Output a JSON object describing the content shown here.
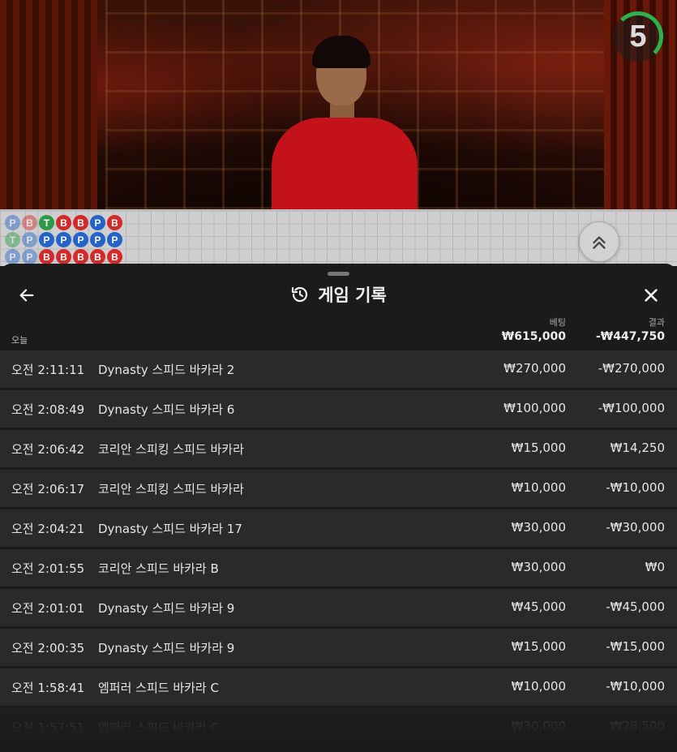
{
  "timer": {
    "value": "5"
  },
  "roadmap": {
    "beads": [
      [
        {
          "l": "P",
          "dim": true
        },
        {
          "l": "T",
          "dim": true
        },
        {
          "l": "P",
          "dim": true
        }
      ],
      [
        {
          "l": "B",
          "dim": true
        },
        {
          "l": "P",
          "dim": true
        },
        {
          "l": "P",
          "dim": true
        }
      ],
      [
        {
          "l": "T",
          "dim": false
        },
        {
          "l": "P",
          "dim": false
        },
        {
          "l": "B",
          "dim": false
        }
      ],
      [
        {
          "l": "B",
          "dim": false
        },
        {
          "l": "P",
          "dim": false
        },
        {
          "l": "B",
          "dim": false
        }
      ],
      [
        {
          "l": "B",
          "dim": false
        },
        {
          "l": "P",
          "dim": false
        },
        {
          "l": "B",
          "dim": false
        }
      ],
      [
        {
          "l": "P",
          "dim": false
        },
        {
          "l": "P",
          "dim": false
        },
        {
          "l": "B",
          "dim": false
        }
      ],
      [
        {
          "l": "B",
          "dim": false
        },
        {
          "l": "P",
          "dim": false
        },
        {
          "l": "B",
          "dim": false
        }
      ]
    ]
  },
  "panel": {
    "title": "게임 기록",
    "today_label": "오늘",
    "bet_label": "베팅",
    "result_label": "결과",
    "total_bet": "₩615,000",
    "total_result": "-₩447,750"
  },
  "rows": [
    {
      "time": "오전 2:11:11",
      "game": "Dynasty 스피드 바카라 2",
      "bet": "₩270,000",
      "result": "-₩270,000"
    },
    {
      "time": "오전 2:08:49",
      "game": "Dynasty 스피드 바카라 6",
      "bet": "₩100,000",
      "result": "-₩100,000"
    },
    {
      "time": "오전 2:06:42",
      "game": "코리안 스피킹 스피드 바카라",
      "bet": "₩15,000",
      "result": "₩14,250"
    },
    {
      "time": "오전 2:06:17",
      "game": "코리안 스피킹 스피드 바카라",
      "bet": "₩10,000",
      "result": "-₩10,000"
    },
    {
      "time": "오전 2:04:21",
      "game": "Dynasty 스피드 바카라 17",
      "bet": "₩30,000",
      "result": "-₩30,000"
    },
    {
      "time": "오전 2:01:55",
      "game": "코리안 스피드 바카라 B",
      "bet": "₩30,000",
      "result": "₩0"
    },
    {
      "time": "오전 2:01:01",
      "game": "Dynasty 스피드 바카라 9",
      "bet": "₩45,000",
      "result": "-₩45,000"
    },
    {
      "time": "오전 2:00:35",
      "game": "Dynasty 스피드 바카라 9",
      "bet": "₩15,000",
      "result": "-₩15,000"
    },
    {
      "time": "오전 1:58:41",
      "game": "엠퍼러 스피드 바카라 C",
      "bet": "₩10,000",
      "result": "-₩10,000"
    },
    {
      "time": "오전 1:57:51",
      "game": "엠퍼러 스피드 바카라 C",
      "bet": "₩30,000",
      "result": "₩28,500"
    }
  ],
  "colors": {
    "timer_ring": "#2bb24c",
    "player": "#2463c9",
    "banker": "#d22a2a",
    "tie": "#2a9a48"
  },
  "icons": {
    "back": "arrow-left-icon",
    "history": "history-icon",
    "close": "close-icon",
    "expand": "chevron-double-up-icon"
  }
}
